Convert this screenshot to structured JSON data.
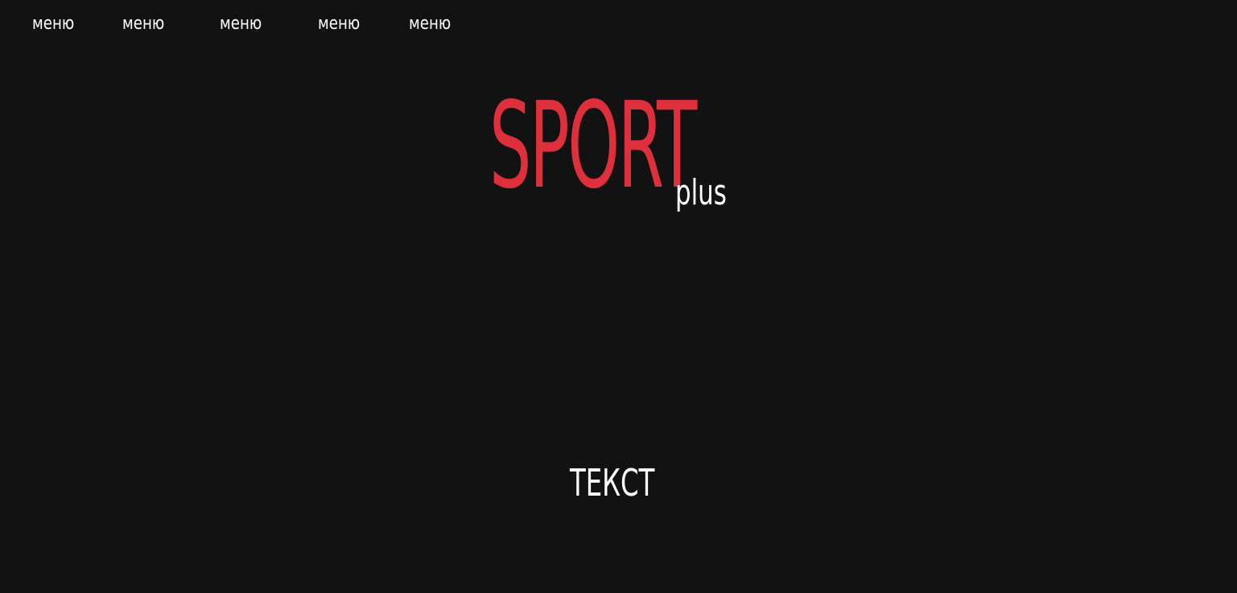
{
  "nav": {
    "items": [
      {
        "label": "меню"
      },
      {
        "label": "меню"
      },
      {
        "label": "меню"
      },
      {
        "label": "меню"
      },
      {
        "label": "меню"
      }
    ]
  },
  "logo": {
    "main": "SPORT",
    "sub": "plus"
  },
  "hero": {
    "text": "ТЕКСТ"
  },
  "colors": {
    "background": "#121212",
    "accent": "#de2f3c",
    "text": "#ffffff"
  }
}
